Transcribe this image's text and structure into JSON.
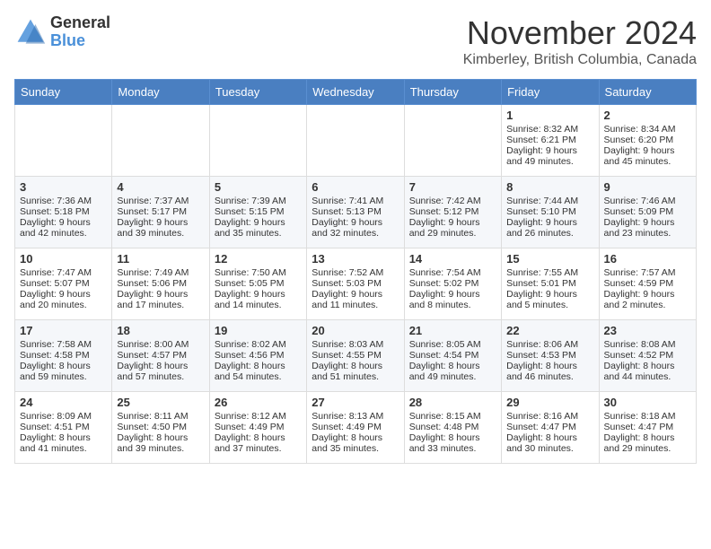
{
  "header": {
    "logo_general": "General",
    "logo_blue": "Blue",
    "month_title": "November 2024",
    "location": "Kimberley, British Columbia, Canada"
  },
  "days_of_week": [
    "Sunday",
    "Monday",
    "Tuesday",
    "Wednesday",
    "Thursday",
    "Friday",
    "Saturday"
  ],
  "weeks": [
    [
      {
        "day": "",
        "info": ""
      },
      {
        "day": "",
        "info": ""
      },
      {
        "day": "",
        "info": ""
      },
      {
        "day": "",
        "info": ""
      },
      {
        "day": "",
        "info": ""
      },
      {
        "day": "1",
        "info": "Sunrise: 8:32 AM\nSunset: 6:21 PM\nDaylight: 9 hours and 49 minutes."
      },
      {
        "day": "2",
        "info": "Sunrise: 8:34 AM\nSunset: 6:20 PM\nDaylight: 9 hours and 45 minutes."
      }
    ],
    [
      {
        "day": "3",
        "info": "Sunrise: 7:36 AM\nSunset: 5:18 PM\nDaylight: 9 hours and 42 minutes."
      },
      {
        "day": "4",
        "info": "Sunrise: 7:37 AM\nSunset: 5:17 PM\nDaylight: 9 hours and 39 minutes."
      },
      {
        "day": "5",
        "info": "Sunrise: 7:39 AM\nSunset: 5:15 PM\nDaylight: 9 hours and 35 minutes."
      },
      {
        "day": "6",
        "info": "Sunrise: 7:41 AM\nSunset: 5:13 PM\nDaylight: 9 hours and 32 minutes."
      },
      {
        "day": "7",
        "info": "Sunrise: 7:42 AM\nSunset: 5:12 PM\nDaylight: 9 hours and 29 minutes."
      },
      {
        "day": "8",
        "info": "Sunrise: 7:44 AM\nSunset: 5:10 PM\nDaylight: 9 hours and 26 minutes."
      },
      {
        "day": "9",
        "info": "Sunrise: 7:46 AM\nSunset: 5:09 PM\nDaylight: 9 hours and 23 minutes."
      }
    ],
    [
      {
        "day": "10",
        "info": "Sunrise: 7:47 AM\nSunset: 5:07 PM\nDaylight: 9 hours and 20 minutes."
      },
      {
        "day": "11",
        "info": "Sunrise: 7:49 AM\nSunset: 5:06 PM\nDaylight: 9 hours and 17 minutes."
      },
      {
        "day": "12",
        "info": "Sunrise: 7:50 AM\nSunset: 5:05 PM\nDaylight: 9 hours and 14 minutes."
      },
      {
        "day": "13",
        "info": "Sunrise: 7:52 AM\nSunset: 5:03 PM\nDaylight: 9 hours and 11 minutes."
      },
      {
        "day": "14",
        "info": "Sunrise: 7:54 AM\nSunset: 5:02 PM\nDaylight: 9 hours and 8 minutes."
      },
      {
        "day": "15",
        "info": "Sunrise: 7:55 AM\nSunset: 5:01 PM\nDaylight: 9 hours and 5 minutes."
      },
      {
        "day": "16",
        "info": "Sunrise: 7:57 AM\nSunset: 4:59 PM\nDaylight: 9 hours and 2 minutes."
      }
    ],
    [
      {
        "day": "17",
        "info": "Sunrise: 7:58 AM\nSunset: 4:58 PM\nDaylight: 8 hours and 59 minutes."
      },
      {
        "day": "18",
        "info": "Sunrise: 8:00 AM\nSunset: 4:57 PM\nDaylight: 8 hours and 57 minutes."
      },
      {
        "day": "19",
        "info": "Sunrise: 8:02 AM\nSunset: 4:56 PM\nDaylight: 8 hours and 54 minutes."
      },
      {
        "day": "20",
        "info": "Sunrise: 8:03 AM\nSunset: 4:55 PM\nDaylight: 8 hours and 51 minutes."
      },
      {
        "day": "21",
        "info": "Sunrise: 8:05 AM\nSunset: 4:54 PM\nDaylight: 8 hours and 49 minutes."
      },
      {
        "day": "22",
        "info": "Sunrise: 8:06 AM\nSunset: 4:53 PM\nDaylight: 8 hours and 46 minutes."
      },
      {
        "day": "23",
        "info": "Sunrise: 8:08 AM\nSunset: 4:52 PM\nDaylight: 8 hours and 44 minutes."
      }
    ],
    [
      {
        "day": "24",
        "info": "Sunrise: 8:09 AM\nSunset: 4:51 PM\nDaylight: 8 hours and 41 minutes."
      },
      {
        "day": "25",
        "info": "Sunrise: 8:11 AM\nSunset: 4:50 PM\nDaylight: 8 hours and 39 minutes."
      },
      {
        "day": "26",
        "info": "Sunrise: 8:12 AM\nSunset: 4:49 PM\nDaylight: 8 hours and 37 minutes."
      },
      {
        "day": "27",
        "info": "Sunrise: 8:13 AM\nSunset: 4:49 PM\nDaylight: 8 hours and 35 minutes."
      },
      {
        "day": "28",
        "info": "Sunrise: 8:15 AM\nSunset: 4:48 PM\nDaylight: 8 hours and 33 minutes."
      },
      {
        "day": "29",
        "info": "Sunrise: 8:16 AM\nSunset: 4:47 PM\nDaylight: 8 hours and 30 minutes."
      },
      {
        "day": "30",
        "info": "Sunrise: 8:18 AM\nSunset: 4:47 PM\nDaylight: 8 hours and 29 minutes."
      }
    ]
  ]
}
